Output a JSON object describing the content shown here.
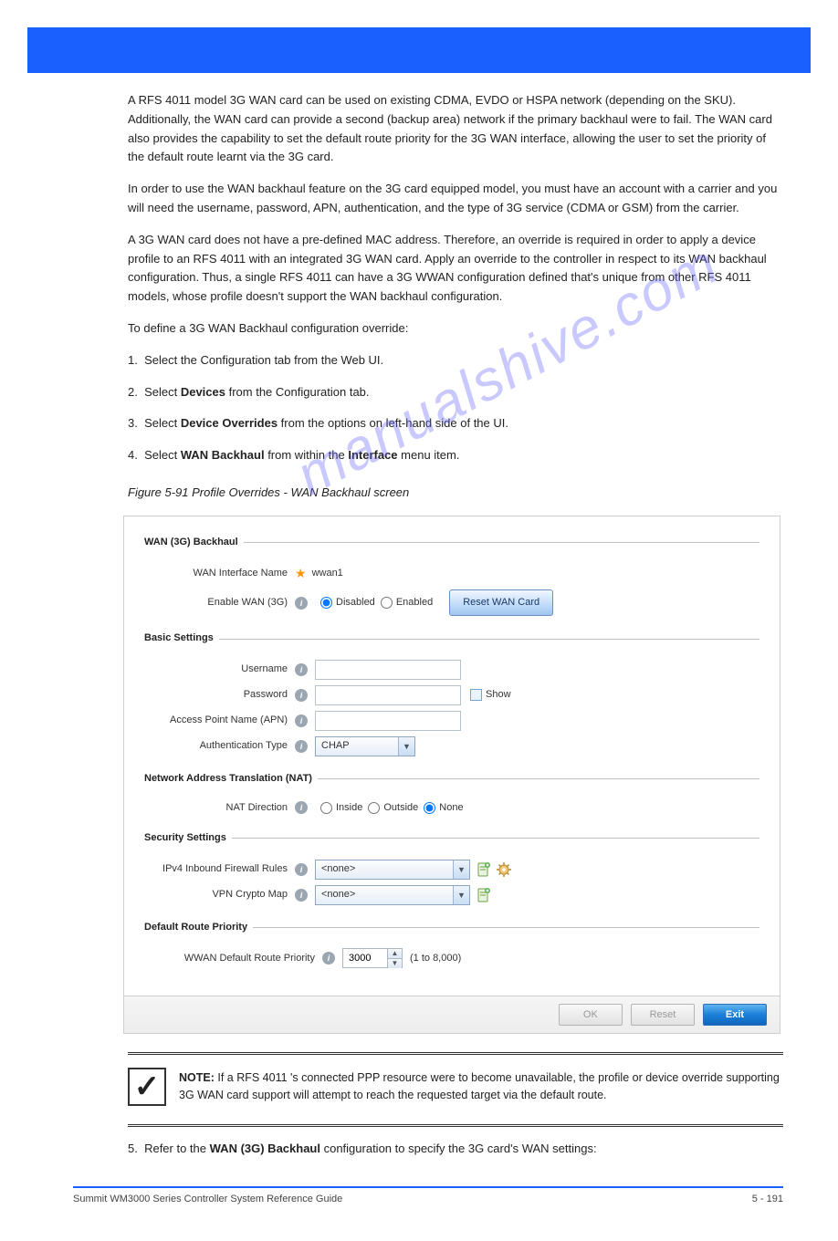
{
  "header": {
    "title": ""
  },
  "watermark": "manualshive.com",
  "body": {
    "p1": "A RFS 4011 model 3G WAN card can be used on existing CDMA, EVDO or HSPA network (depending on the SKU). Additionally, the WAN card can provide a second (backup area) network if the primary backhaul were to fail. The WAN card also provides the capability to set the default route priority for the 3G WAN interface, allowing the user to set the priority of the default route learnt via the 3G card.",
    "p2": "In order to use the WAN backhaul feature on the 3G card equipped model, you must have an account with a carrier and you will need the username, password, APN, authentication, and the type of 3G service (CDMA or GSM) from the carrier.",
    "p3": "A 3G WAN card does not have a pre-defined MAC address. Therefore, an override is required in order to apply a device profile to an RFS 4011 with an integrated 3G WAN card. Apply an override to the controller in respect to its WAN backhaul configuration. Thus, a single RFS 4011 can have a 3G WWAN configuration defined that's unique from other RFS 4011 models, whose profile doesn't support the WAN backhaul configuration.",
    "p4": "To define a 3G WAN Backhaul configuration override:",
    "step1": "Select the Configuration tab from the Web UI.",
    "step2_a": "Select ",
    "step2_b": "Devices",
    "step2_c": " from the Configuration tab.",
    "step3_a": "Select ",
    "step3_b": "Device Overrides",
    "step3_c": " from the options on left-hand side of the UI.",
    "step4_a": "Select ",
    "step4_b": "WAN Backhaul",
    "step4_c": " from within the ",
    "step4_d": "Interface",
    "step4_e": " menu item.",
    "fig_caption": "Figure 5-91 Profile Overrides - WAN Backhaul screen",
    "step5_a": "Refer to the ",
    "step5_b": "WAN (3G) Backhaul",
    "step5_c": " configuration to specify the 3G card's WAN settings:"
  },
  "dialog": {
    "section1": {
      "legend": "WAN (3G) Backhaul",
      "wan_if_label": "WAN Interface Name",
      "wan_if_value": "wwan1",
      "enable_label": "Enable WAN (3G)",
      "opt_disabled": "Disabled",
      "opt_enabled": "Enabled",
      "reset_btn": "Reset WAN Card"
    },
    "section2": {
      "legend": "Basic Settings",
      "username_label": "Username",
      "password_label": "Password",
      "show_label": "Show",
      "apn_label": "Access Point Name (APN)",
      "auth_label": "Authentication Type",
      "auth_value": "CHAP"
    },
    "section3": {
      "legend": "Network Address Translation (NAT)",
      "nat_label": "NAT Direction",
      "opt_inside": "Inside",
      "opt_outside": "Outside",
      "opt_none": "None"
    },
    "section4": {
      "legend": "Security Settings",
      "fw_label": "IPv4 Inbound Firewall Rules",
      "fw_value": "<none>",
      "vpn_label": "VPN Crypto Map",
      "vpn_value": "<none>"
    },
    "section5": {
      "legend": "Default Route Priority",
      "prio_label": "WWAN Default Route Priority",
      "prio_value": "3000",
      "prio_hint": "(1 to 8,000)"
    },
    "footer": {
      "ok": "OK",
      "reset": "Reset",
      "exit": "Exit"
    }
  },
  "note": {
    "label": "NOTE:",
    "text": " If a RFS 4011 's connected PPP resource were to become unavailable, the profile or device override supporting 3G WAN card support will attempt to reach the requested target via the default route."
  },
  "footer": {
    "left": "Summit WM3000 Series Controller System Reference Guide",
    "right": "5 - 191"
  }
}
